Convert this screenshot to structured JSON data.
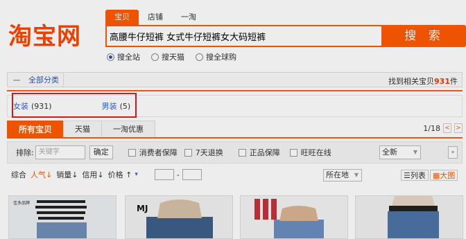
{
  "logo": {
    "text": "淘宝网"
  },
  "search": {
    "tabs": [
      {
        "label": "宝贝",
        "active": true
      },
      {
        "label": "店铺",
        "active": false
      },
      {
        "label": "一淘",
        "active": false
      }
    ],
    "value": "高腰牛仔短裤 女式牛仔短裤女大码短裤",
    "button_label": "搜 索",
    "scope_options": [
      {
        "label": "搜全站",
        "selected": true
      },
      {
        "label": "搜天猫",
        "selected": false
      },
      {
        "label": "搜全球购",
        "selected": false
      }
    ]
  },
  "category_bar": {
    "all_label": "全部分类",
    "found_prefix": "找到相关宝贝",
    "found_count": "931",
    "found_suffix": "件"
  },
  "sub_categories": [
    {
      "label": "女装",
      "count": "(931)"
    },
    {
      "label": "男装",
      "count": "(5)"
    }
  ],
  "result_tabs": [
    {
      "label": "所有宝贝",
      "active": true
    },
    {
      "label": "天猫",
      "active": false
    },
    {
      "label": "一淘优惠",
      "active": false
    }
  ],
  "pager": {
    "text": "1/18",
    "prev": "<",
    "next": ">"
  },
  "toolbar": {
    "exclude_label": "排除:",
    "exclude_placeholder": "关键字",
    "confirm_label": "确定",
    "checkboxes": [
      "消费者保障",
      "7天退换",
      "正品保障",
      "旺旺在线"
    ],
    "dropdown_value": "全新"
  },
  "sort": {
    "options": [
      {
        "label": "综合",
        "active": false
      },
      {
        "label": "人气",
        "arrow": "↓",
        "active": true
      },
      {
        "label": "销量",
        "arrow": "↓",
        "active": false
      },
      {
        "label": "信用",
        "arrow": "↓",
        "active": false
      },
      {
        "label": "价格",
        "arrow": "↑",
        "active": false
      }
    ],
    "price_sep": "-",
    "location_label": "所在地",
    "list_view": "列表",
    "grid_view": "大图"
  },
  "products": [
    {
      "brand_text": "佳多品牌"
    },
    {
      "brand_text": "MJ"
    },
    {
      "brand_text": ""
    },
    {
      "brand_text": ""
    }
  ],
  "colors": {
    "accent": "#ff5a00",
    "link": "#3366cc",
    "highlight": "#e21a1a"
  }
}
